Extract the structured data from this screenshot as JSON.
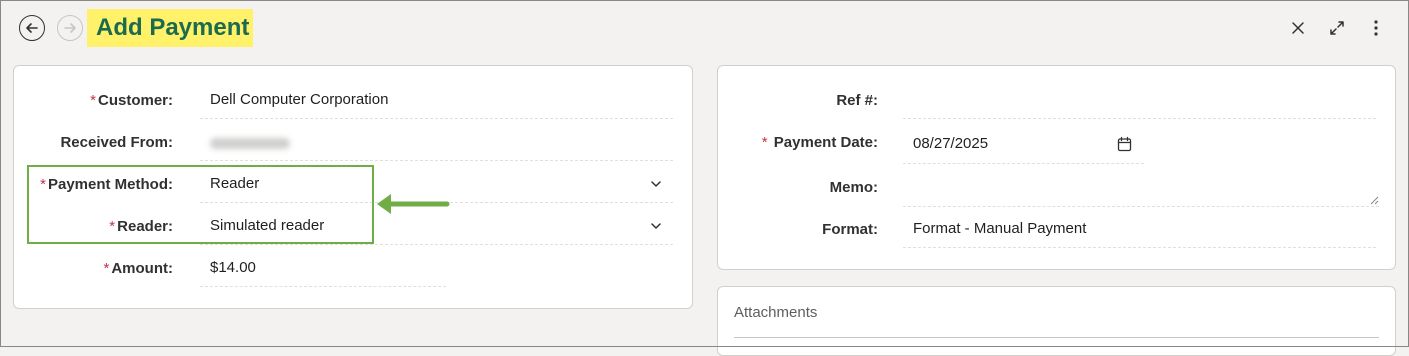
{
  "header": {
    "title": "Add Payment",
    "icons": [
      "back-arrow-icon",
      "forward-arrow-icon",
      "close-icon",
      "expand-icon",
      "more-vertical-icon"
    ],
    "title_highlight_color": "#fff16a",
    "title_color": "#1c6b4e"
  },
  "left_form": {
    "customer": {
      "label": "Customer:",
      "required_mark": "*",
      "value": "Dell Computer Corporation"
    },
    "received_from": {
      "label": "Received From:"
    },
    "payment_method": {
      "label": "Payment Method:",
      "required_mark": "*",
      "value": "Reader"
    },
    "reader": {
      "label": "Reader:",
      "required_mark": "*",
      "value": "Simulated reader"
    },
    "amount": {
      "label": "Amount:",
      "required_mark": "*",
      "value": "$14.00"
    }
  },
  "right_form": {
    "ref": {
      "label": "Ref #:",
      "value": ""
    },
    "payment_date": {
      "label": "Payment Date:",
      "required_mark": "*",
      "value": "08/27/2025"
    },
    "memo": {
      "label": "Memo:",
      "value": ""
    },
    "format": {
      "label": "Format:",
      "value": "Format - Manual Payment"
    }
  },
  "attachments": {
    "title": "Attachments"
  },
  "annotation": {
    "highlight_color": "#70ad47"
  }
}
